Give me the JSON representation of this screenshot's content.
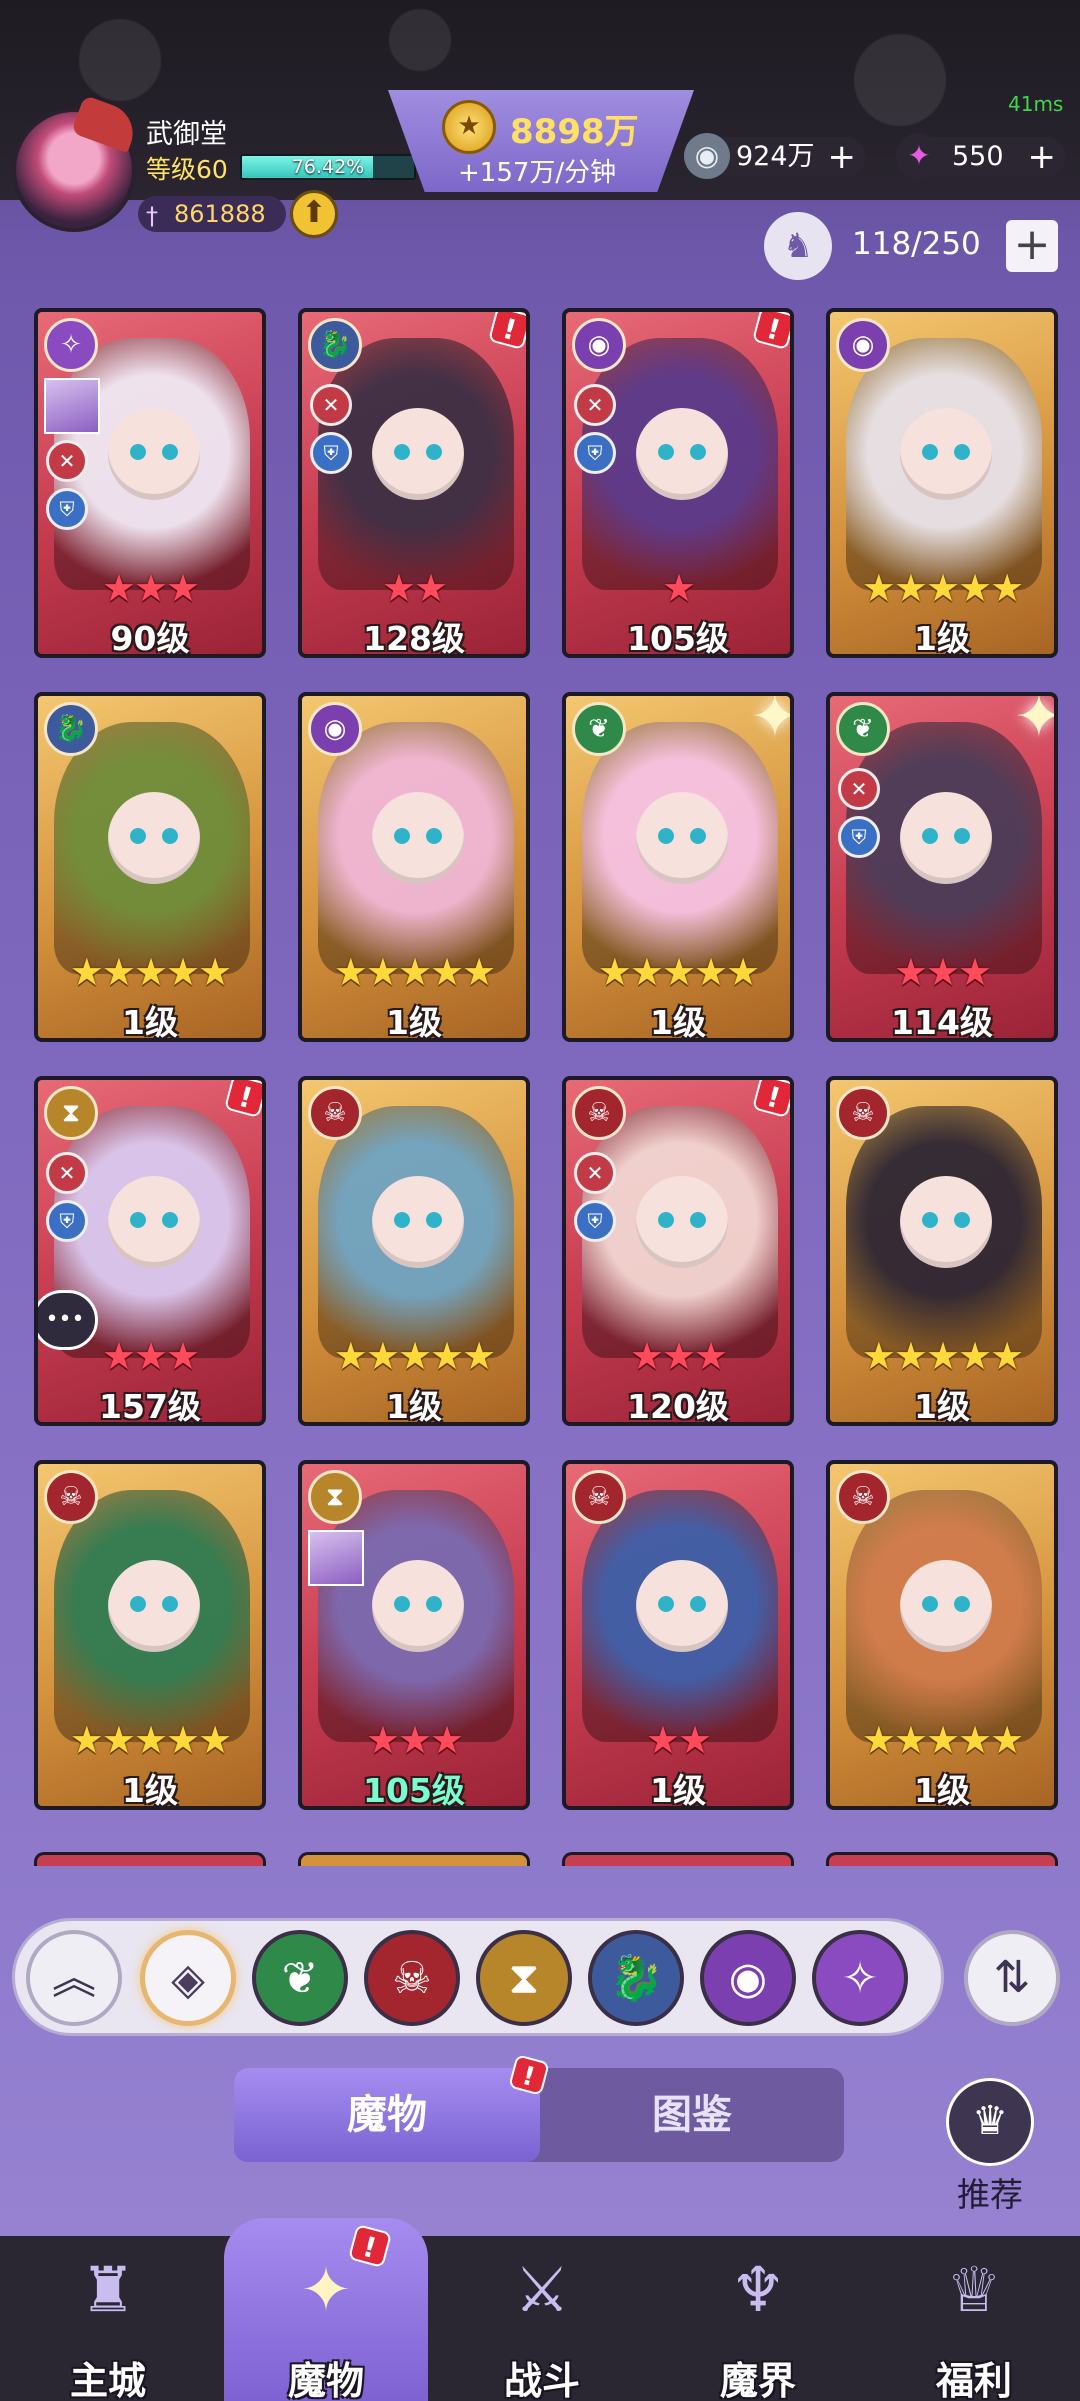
{
  "header": {
    "player_name": "武御堂",
    "level_label": "等级60",
    "xp_percent_text": "76.42%",
    "xp_fraction": 0.7642,
    "power": "861888",
    "ping": "41ms",
    "gold_amount": "8898万",
    "gold_rate": "+157万/分钟",
    "silver_amount": "924万",
    "gem_amount": "550",
    "plus": "+",
    "slots": "118/250"
  },
  "cards": [
    {
      "level": "90级",
      "stars": 3,
      "star_color": "red",
      "frame": "red",
      "element": "storm",
      "alert": false,
      "atk": true,
      "def": true
    },
    {
      "level": "128级",
      "stars": 2,
      "star_color": "red",
      "frame": "red",
      "element": "dragon",
      "alert": true,
      "atk": true,
      "def": true
    },
    {
      "level": "105级",
      "stars": 1,
      "star_color": "red",
      "frame": "red",
      "element": "eye",
      "alert": true,
      "atk": true,
      "def": true
    },
    {
      "level": "1级",
      "stars": 5,
      "star_color": "gold",
      "frame": "gold",
      "element": "eye",
      "alert": false,
      "atk": false,
      "def": false
    },
    {
      "level": "1级",
      "stars": 5,
      "star_color": "gold",
      "frame": "gold",
      "element": "dragon",
      "alert": false,
      "atk": false,
      "def": false
    },
    {
      "level": "1级",
      "stars": 5,
      "star_color": "gold",
      "frame": "gold",
      "element": "eye",
      "alert": false,
      "atk": false,
      "def": false
    },
    {
      "level": "1级",
      "stars": 5,
      "star_color": "gold",
      "frame": "gold",
      "element": "nature",
      "alert": false,
      "atk": false,
      "def": false,
      "sparkle": true
    },
    {
      "level": "114级",
      "stars": 3,
      "star_color": "red",
      "frame": "red",
      "element": "nature",
      "alert": false,
      "atk": true,
      "def": true,
      "sparkle": true
    },
    {
      "level": "157级",
      "stars": 3,
      "star_color": "red",
      "frame": "red",
      "element": "time",
      "alert": true,
      "atk": true,
      "def": true,
      "chat": true
    },
    {
      "level": "1级",
      "stars": 5,
      "star_color": "gold",
      "frame": "gold",
      "element": "demon",
      "alert": false,
      "atk": false,
      "def": false
    },
    {
      "level": "120级",
      "stars": 3,
      "star_color": "red",
      "frame": "red",
      "element": "demon",
      "alert": true,
      "atk": true,
      "def": true
    },
    {
      "level": "1级",
      "stars": 5,
      "star_color": "gold",
      "frame": "gold",
      "element": "demon",
      "alert": false,
      "atk": false,
      "def": false
    },
    {
      "level": "1级",
      "stars": 5,
      "star_color": "gold",
      "frame": "gold",
      "element": "demon",
      "alert": false,
      "atk": false,
      "def": false
    },
    {
      "level": "105级",
      "stars": 3,
      "star_color": "red",
      "frame": "red",
      "element": "time",
      "alert": false,
      "atk": false,
      "def": false,
      "green_level": true
    },
    {
      "level": "1级",
      "stars": 2,
      "star_color": "red",
      "frame": "red",
      "element": "demon",
      "alert": false,
      "atk": false,
      "def": false
    },
    {
      "level": "1级",
      "stars": 5,
      "star_color": "gold",
      "frame": "gold",
      "element": "demon",
      "alert": false,
      "atk": false,
      "def": false
    }
  ],
  "filters": [
    "up",
    "all",
    "nature",
    "demon",
    "time",
    "dragon",
    "eye",
    "storm"
  ],
  "tabs": {
    "monster": "魔物",
    "book": "图鉴"
  },
  "recommend_label": "推荐",
  "nav": [
    {
      "label": "主城",
      "icon": "castle-icon"
    },
    {
      "label": "魔物",
      "icon": "flame-star-icon"
    },
    {
      "label": "战斗",
      "icon": "sword-icon"
    },
    {
      "label": "魔界",
      "icon": "demon-realm-icon"
    },
    {
      "label": "福利",
      "icon": "chest-icon"
    }
  ]
}
